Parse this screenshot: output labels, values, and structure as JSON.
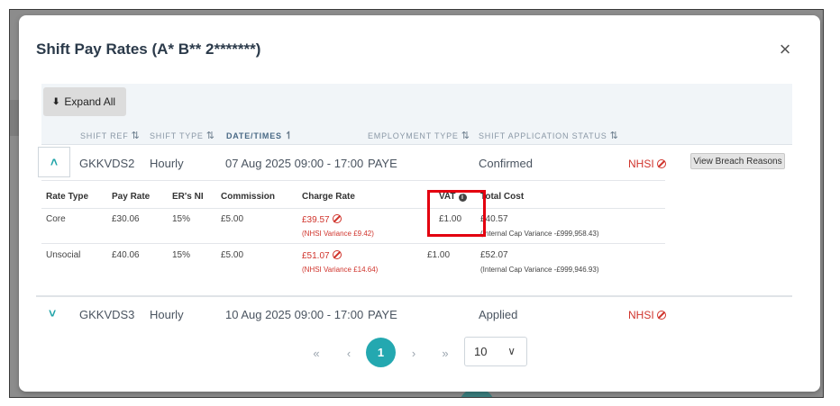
{
  "modal": {
    "title": "Shift Pay Rates (A* B** 2*******)",
    "close_label": "×",
    "expand_all_label": "Expand All"
  },
  "columns": {
    "shift_ref": "SHIFT REF",
    "shift_type": "SHIFT TYPE",
    "date_times": "DATE/TIMES",
    "employment_type": "EMPLOYMENT TYPE",
    "application_status": "SHIFT APPLICATION STATUS"
  },
  "shifts": [
    {
      "ref": "GKKVDS2",
      "type": "Hourly",
      "datetime": "07 Aug 2025 09:00 - 17:00",
      "employment": "PAYE",
      "status": "Confirmed",
      "flag": "NHSI",
      "breach_button": "View Breach Reasons",
      "expanded": true
    },
    {
      "ref": "GKKVDS3",
      "type": "Hourly",
      "datetime": "10 Aug 2025 09:00 - 17:00",
      "employment": "PAYE",
      "status": "Applied",
      "flag": "NHSI",
      "expanded": false
    }
  ],
  "rates": {
    "headers": {
      "rate_type": "Rate Type",
      "pay_rate": "Pay Rate",
      "ers_ni": "ER's NI",
      "commission": "Commission",
      "charge_rate": "Charge Rate",
      "vat": "VAT",
      "total_cost": "Total Cost"
    },
    "rows": [
      {
        "rate_type": "Core",
        "pay_rate": "£30.06",
        "ers_ni": "15%",
        "commission": "£5.00",
        "charge_rate": "£39.57",
        "charge_note": "(NHSI Variance £9.42)",
        "vat": "£1.00",
        "total_cost": "£40.57",
        "total_note": "(Internal Cap Variance -£999,958.43)"
      },
      {
        "rate_type": "Unsocial",
        "pay_rate": "£40.06",
        "ers_ni": "15%",
        "commission": "£5.00",
        "charge_rate": "£51.07",
        "charge_note": "(NHSI Variance £14.64)",
        "vat": "£1.00",
        "total_cost": "£52.07",
        "total_note": "(Internal Cap Variance -£999,946.93)"
      }
    ]
  },
  "pagination": {
    "first": "«",
    "prev": "‹",
    "current": "1",
    "next": "›",
    "last": "»",
    "page_size": "10"
  },
  "colors": {
    "accent": "#24a8b0",
    "breach_red": "#d0342c",
    "highlight": "#e3000f"
  }
}
